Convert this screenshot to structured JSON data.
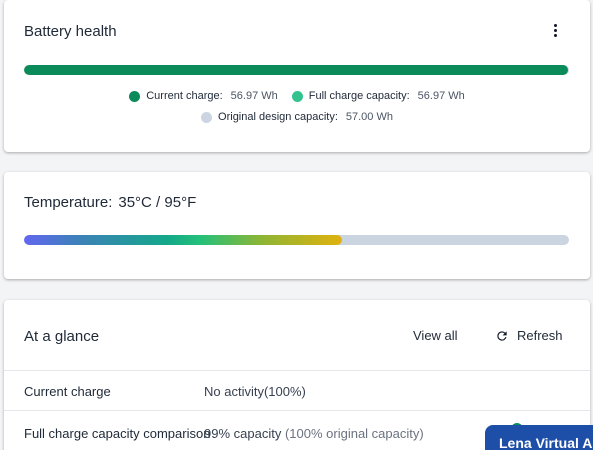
{
  "battery_health": {
    "title": "Battery health",
    "menu_icon": "kebab-menu-icon",
    "charge_fraction": 0.9982,
    "legend": [
      {
        "label": "Current charge:",
        "value": "56.97 Wh",
        "color": "#0b8a5a"
      },
      {
        "label": "Full charge capacity:",
        "value": "56.97 Wh",
        "color": "#34c38f"
      },
      {
        "label": "Original design capacity:",
        "value": "57.00 Wh",
        "color": "#cbd5e1"
      }
    ]
  },
  "temperature": {
    "label": "Temperature:",
    "value": "35°C / 95°F",
    "level_fraction": 0.583
  },
  "at_a_glance": {
    "title": "At a glance",
    "view_all_label": "View all",
    "refresh_label": "Refresh",
    "refresh_icon": "refresh-icon",
    "rows": [
      {
        "label": "Current charge",
        "value": "No activity(100%)",
        "sub": ""
      },
      {
        "label": "Full charge capacity comparison",
        "value": "99% capacity",
        "sub": "(100% original capacity)"
      }
    ]
  },
  "virtual_assistant": {
    "label": "Lena Virtual Assistant"
  },
  "colors": {
    "health_bar": "#0b8a5a",
    "track": "#cbd5e1",
    "assistant": "#1e4fa8"
  }
}
